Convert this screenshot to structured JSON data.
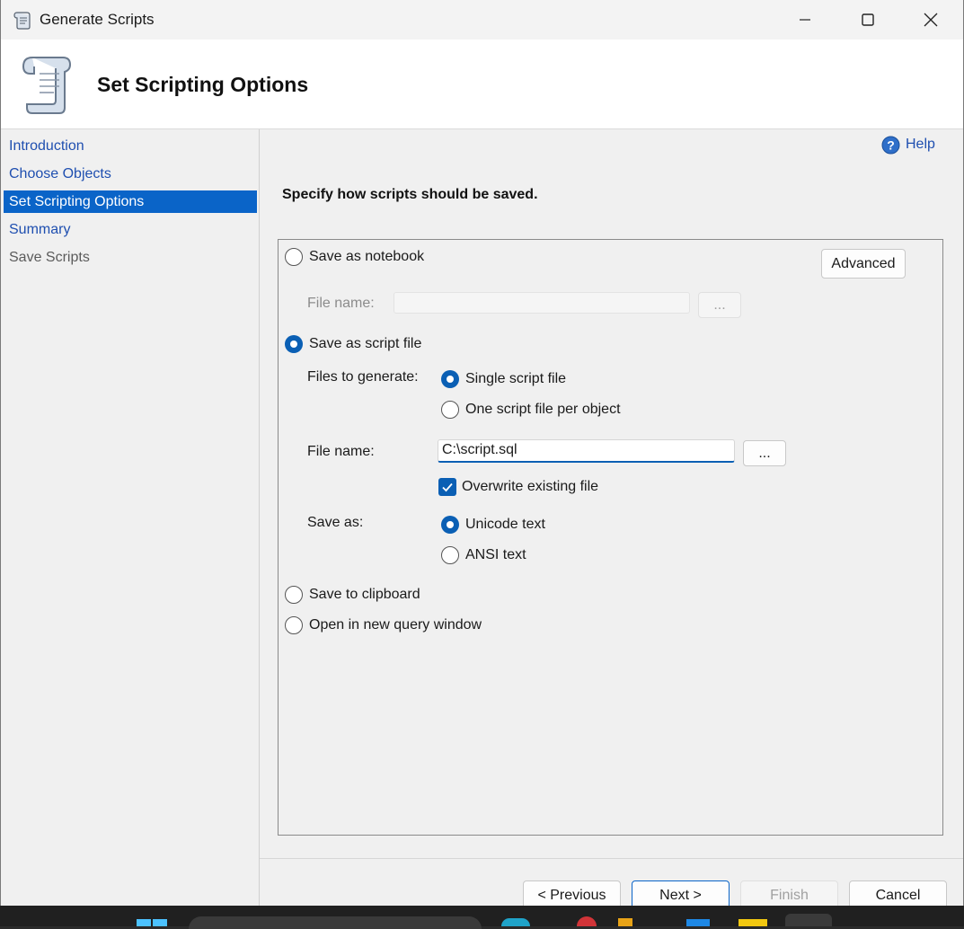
{
  "window": {
    "title": "Generate Scripts"
  },
  "header": {
    "title": "Set Scripting Options"
  },
  "nav": {
    "items": [
      {
        "label": "Introduction",
        "state": "link"
      },
      {
        "label": "Choose Objects",
        "state": "link"
      },
      {
        "label": "Set Scripting Options",
        "state": "active"
      },
      {
        "label": "Summary",
        "state": "link"
      },
      {
        "label": "Save Scripts",
        "state": "disabled"
      }
    ]
  },
  "help": {
    "label": "Help"
  },
  "main": {
    "instruction": "Specify how scripts should be saved.",
    "advanced_label": "Advanced",
    "save_as_notebook": {
      "label": "Save as notebook",
      "selected": false
    },
    "notebook_file": {
      "label": "File name:",
      "value": "",
      "browse_label": "..."
    },
    "save_as_script_file": {
      "label": "Save as script file",
      "selected": true
    },
    "files_to_generate": {
      "label": "Files to generate:",
      "options": [
        {
          "label": "Single script file",
          "selected": true
        },
        {
          "label": "One script file per object",
          "selected": false
        }
      ]
    },
    "script_file": {
      "label": "File name:",
      "value": "C:\\script.sql",
      "browse_label": "..."
    },
    "overwrite": {
      "label": "Overwrite existing file",
      "checked": true
    },
    "save_as": {
      "label": "Save as:",
      "options": [
        {
          "label": "Unicode text",
          "selected": true
        },
        {
          "label": "ANSI text",
          "selected": false
        }
      ]
    },
    "save_to_clipboard": {
      "label": "Save to clipboard",
      "selected": false
    },
    "open_in_query_window": {
      "label": "Open in new query window",
      "selected": false
    }
  },
  "footer": {
    "previous_label": "< Previous",
    "next_label": "Next >",
    "finish_label": "Finish",
    "cancel_label": "Cancel"
  },
  "colors": {
    "accent": "#0a64c8",
    "link": "#1f4fb0"
  }
}
